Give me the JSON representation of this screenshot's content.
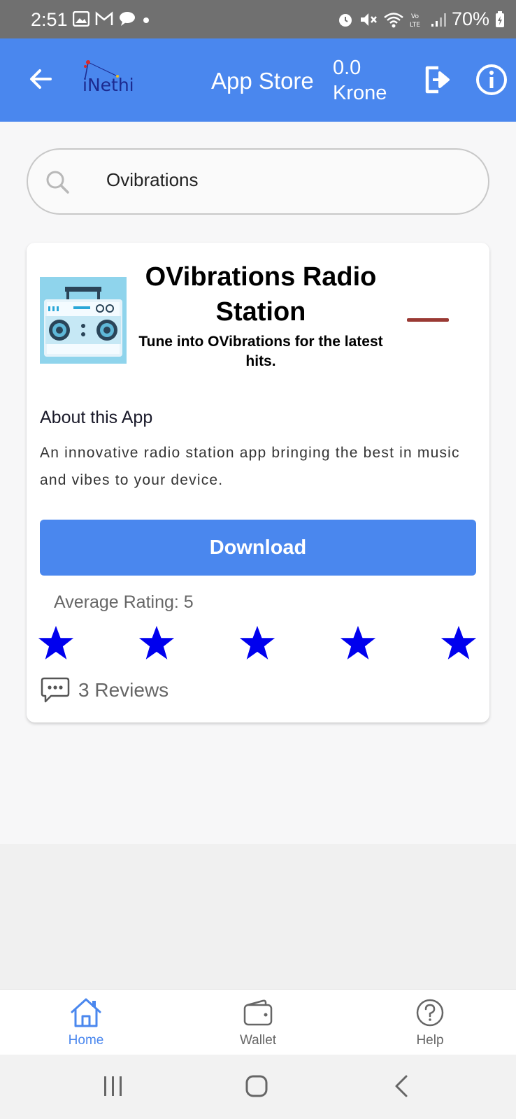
{
  "status_bar": {
    "time": "2:51",
    "battery": "70%"
  },
  "app_bar": {
    "logo_text": "iNethi",
    "title": "App Store",
    "balance_amount": "0.0",
    "balance_currency": "Krone"
  },
  "search": {
    "value": "Ovibrations"
  },
  "app": {
    "name": "OVibrations Radio Station",
    "tagline": "Tune into OVibrations for the latest hits.",
    "about_title": "About this App",
    "about_text": "An innovative radio station app bringing the best in music and vibes to your device.",
    "download_label": "Download",
    "average_rating_label": "Average Rating: 5",
    "rating": 5,
    "max_rating": 5,
    "reviews_label": "3 Reviews"
  },
  "bottom_nav": {
    "items": [
      {
        "label": "Home",
        "icon": "home-icon",
        "active": true
      },
      {
        "label": "Wallet",
        "icon": "wallet-icon",
        "active": false
      },
      {
        "label": "Help",
        "icon": "help-icon",
        "active": false
      }
    ]
  },
  "colors": {
    "primary": "#4a87ee",
    "star": "#0000ee",
    "remove_bar": "#9a3a34",
    "status_bar": "#707070"
  }
}
